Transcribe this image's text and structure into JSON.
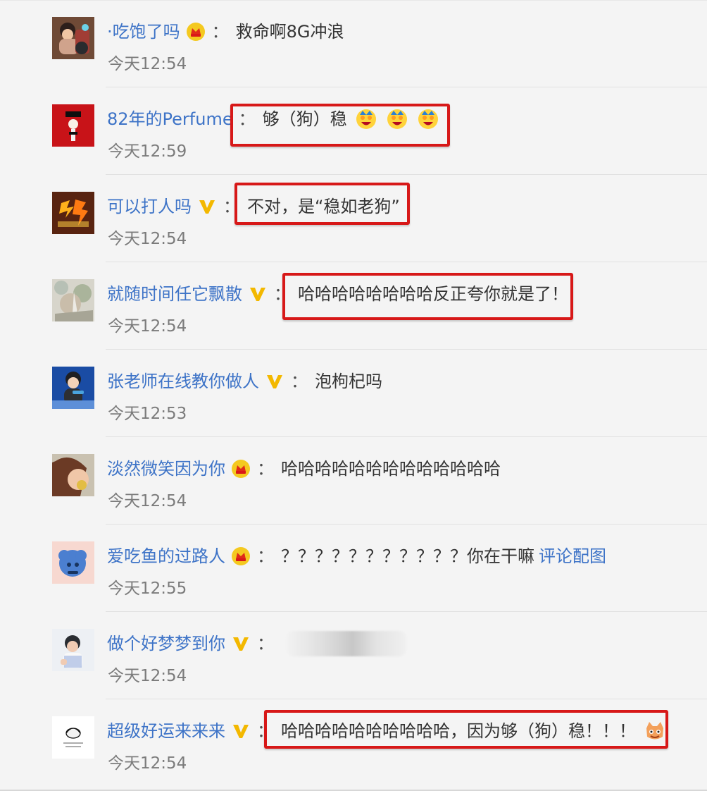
{
  "comments": [
    {
      "username": "·吃饱了吗",
      "badge": "crown-badge-icon",
      "separator": "：",
      "text": "救命啊8G冲浪",
      "time": "今天12:54",
      "avatar": "avatar-icon",
      "highlighted": false
    },
    {
      "username": "82年的Perfume",
      "badge": "",
      "separator": "：",
      "text": "够（狗）稳",
      "emojis": [
        "laughing-crown-emoji-icon",
        "laughing-crown-emoji-icon",
        "laughing-crown-emoji-icon"
      ],
      "time": "今天12:59",
      "avatar": "avatar-icon",
      "highlighted": true
    },
    {
      "username": "可以打人吗",
      "badge": "verified-v-icon",
      "separator": "：",
      "text": "不对，是“稳如老狗”",
      "time": "今天12:54",
      "avatar": "avatar-icon",
      "highlighted": true
    },
    {
      "username": "就随时间任它飘散",
      "badge": "verified-v-icon",
      "separator": "：",
      "text": "哈哈哈哈哈哈哈哈反正夸你就是了！",
      "time": "今天12:54",
      "avatar": "avatar-icon",
      "highlighted": true
    },
    {
      "username": "张老师在线教你做人",
      "badge": "verified-v-icon",
      "separator": "：",
      "text": "泡枸杞吗",
      "time": "今天12:53",
      "avatar": "avatar-icon",
      "highlighted": false
    },
    {
      "username": "淡然微笑因为你",
      "badge": "crown-badge-icon",
      "separator": "：",
      "text": "哈哈哈哈哈哈哈哈哈哈哈哈哈",
      "time": "今天12:54",
      "avatar": "avatar-icon",
      "highlighted": false
    },
    {
      "username": "爱吃鱼的过路人",
      "badge": "crown-badge-icon",
      "separator": "：",
      "text": "？？？？？？？？？？？你在干嘛",
      "link_text": "评论配图",
      "time": "今天12:55",
      "avatar": "avatar-icon",
      "highlighted": false
    },
    {
      "username": "做个好梦梦到你",
      "badge": "verified-v-icon",
      "separator": "：",
      "text": "",
      "time": "今天12:54",
      "avatar": "avatar-icon",
      "highlighted": false
    },
    {
      "username": "超级好运来来来",
      "badge": "verified-v-icon",
      "separator": "：",
      "text": "哈哈哈哈哈哈哈哈哈哈，因为够（狗）稳！！！",
      "emojis": [
        "cat-face-emoji-icon"
      ],
      "time": "今天12:54",
      "avatar": "avatar-icon",
      "highlighted": true
    }
  ],
  "colors": {
    "background": "#f4f4f4",
    "username": "#3d73c7",
    "text": "#333333",
    "time": "#7b7b7b",
    "highlight": "#d71818",
    "crown": "#f0b21b",
    "verified": "#f3b800"
  }
}
